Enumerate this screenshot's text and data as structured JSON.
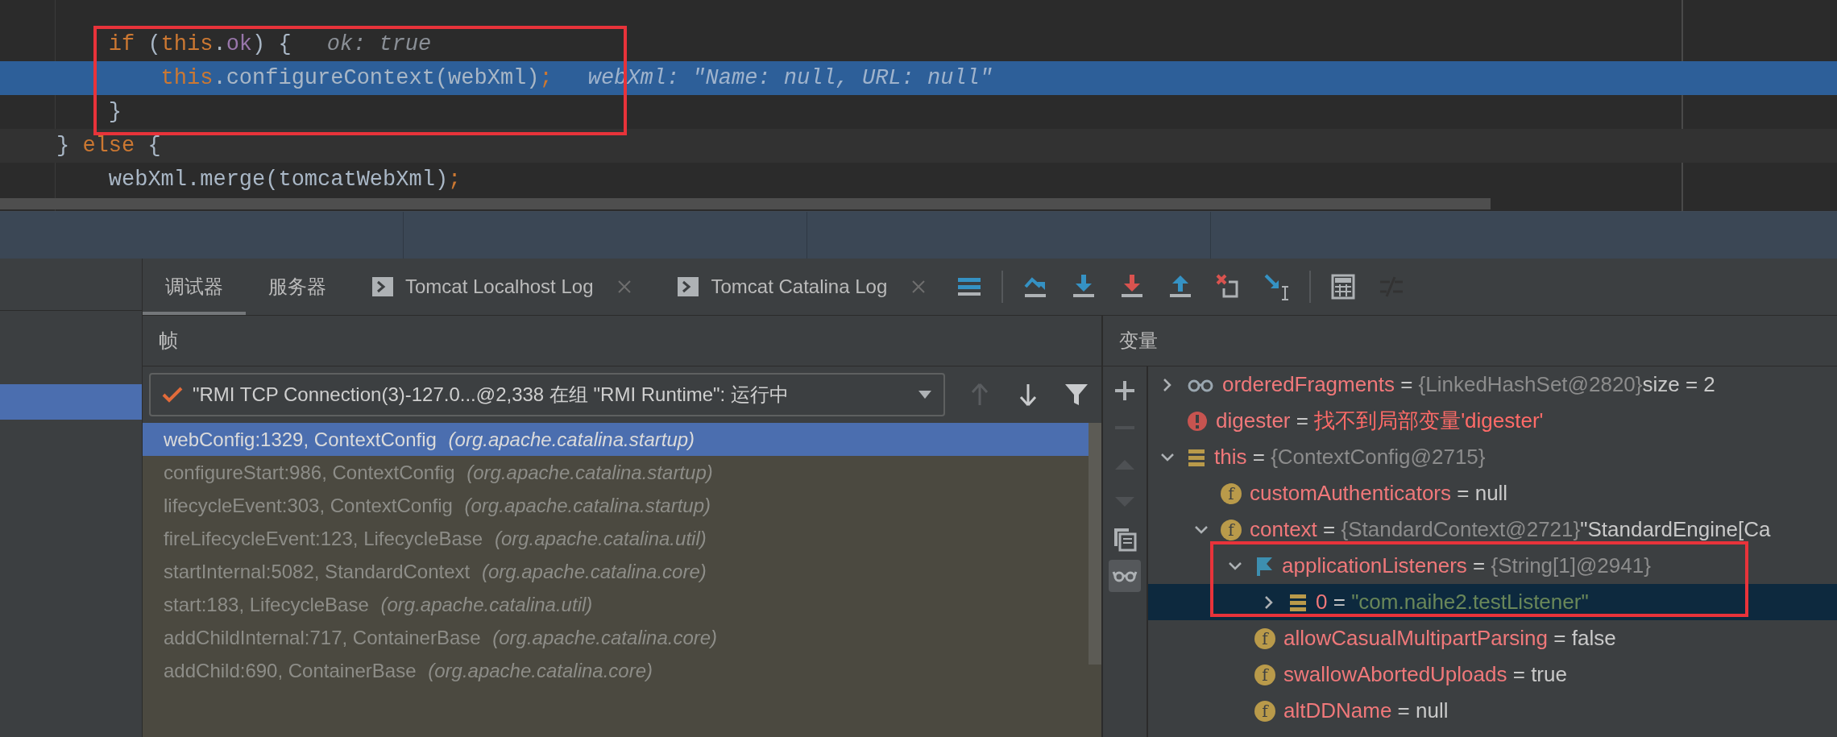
{
  "editor": {
    "lines": [
      {
        "kind": "plain",
        "tokens": [
          {
            "t": "    if",
            "kind": "keyword"
          },
          {
            "t": " (",
            "kind": "plain"
          },
          {
            "t": "this",
            "kind": "keyword"
          },
          {
            "t": ".",
            "kind": "plain"
          },
          {
            "t": "ok",
            "kind": "field"
          },
          {
            "t": ") {",
            "kind": "plain"
          }
        ],
        "hint": "ok: true"
      },
      {
        "kind": "execution",
        "tokens": [
          {
            "t": "        this",
            "kind": "keyword"
          },
          {
            "t": ".configureContext(webXml)",
            "kind": "plain"
          },
          {
            "t": ";",
            "kind": "keyword"
          }
        ],
        "hint": "webXml: \"Name: null, URL: null\""
      },
      {
        "kind": "plain",
        "tokens": [
          {
            "t": "    }",
            "kind": "plain"
          }
        ]
      },
      {
        "kind": "caret",
        "tokens": [
          {
            "t": "} ",
            "kind": "plain"
          },
          {
            "t": "else",
            "kind": "keyword"
          },
          {
            "t": " {",
            "kind": "plain"
          }
        ]
      },
      {
        "kind": "plain",
        "tokens": [
          {
            "t": "    webXml.merge(tomcatWebXml)",
            "kind": "plain"
          },
          {
            "t": ";",
            "kind": "keyword"
          }
        ]
      }
    ]
  },
  "tabs": [
    {
      "label": "调试器",
      "selected": true,
      "kind": "plain"
    },
    {
      "label": "服务器",
      "selected": false,
      "kind": "plain"
    },
    {
      "label": "Tomcat Localhost Log",
      "selected": false,
      "kind": "console"
    },
    {
      "label": "Tomcat Catalina Log",
      "selected": false,
      "kind": "console"
    }
  ],
  "toolbar": [
    {
      "kind": "lines",
      "disabled": false
    },
    {
      "kind": "over",
      "disabled": false
    },
    {
      "kind": "into",
      "disabled": false
    },
    {
      "kind": "force",
      "disabled": false
    },
    {
      "kind": "out",
      "disabled": false
    },
    {
      "kind": "drop",
      "disabled": false
    },
    {
      "kind": "cursor",
      "disabled": false
    },
    {
      "kind": "calc",
      "disabled": false
    },
    {
      "kind": "trace",
      "disabled": true
    }
  ],
  "frames": {
    "header": "帧",
    "thread": "\"RMI TCP Connection(3)-127.0...@2,338 在组 \"RMI Runtime\": 运行中",
    "tools": [
      {
        "kind": "up",
        "disabled": true
      },
      {
        "kind": "down",
        "disabled": false
      },
      {
        "kind": "filter",
        "disabled": false
      }
    ],
    "items": [
      {
        "location": "webConfig:1329, ContextConfig",
        "package": "(org.apache.catalina.startup)",
        "selected": true
      },
      {
        "location": "configureStart:986, ContextConfig",
        "package": "(org.apache.catalina.startup)",
        "selected": false
      },
      {
        "location": "lifecycleEvent:303, ContextConfig",
        "package": "(org.apache.catalina.startup)",
        "selected": false
      },
      {
        "location": "fireLifecycleEvent:123, LifecycleBase",
        "package": "(org.apache.catalina.util)",
        "selected": false
      },
      {
        "location": "startInternal:5082, StandardContext",
        "package": "(org.apache.catalina.core)",
        "selected": false
      },
      {
        "location": "start:183, LifecycleBase",
        "package": "(org.apache.catalina.util)",
        "selected": false
      },
      {
        "location": "addChildInternal:717, ContainerBase",
        "package": "(org.apache.catalina.core)",
        "selected": false
      },
      {
        "location": "addChild:690, ContainerBase",
        "package": "(org.apache.catalina.core)",
        "selected": false
      }
    ]
  },
  "variables": {
    "header": "变量",
    "tools": [
      {
        "kind": "plus",
        "disabled": false,
        "on": false
      },
      {
        "kind": "minus",
        "disabled": true,
        "on": false
      },
      {
        "kind": "up",
        "disabled": true,
        "on": false
      },
      {
        "kind": "down",
        "disabled": true,
        "on": false
      },
      {
        "kind": "copy",
        "disabled": false,
        "on": false
      },
      {
        "kind": "glasses",
        "disabled": false,
        "on": true
      }
    ],
    "nodes": [
      {
        "kind": "watch",
        "name": "orderedFragments",
        "op": "=",
        "value": {
          "text": "{LinkedHashSet@2820}",
          "kind": "ref"
        },
        "extra": "size = 2",
        "expanded": false,
        "selected": false
      },
      {
        "kind": "error",
        "name": "digester",
        "op": "=",
        "value": {
          "text": "找不到局部变量'digester'",
          "kind": "error"
        },
        "selected": false
      },
      {
        "kind": "list",
        "name": "this",
        "op": "=",
        "value": {
          "text": "{ContextConfig@2715}",
          "kind": "ref"
        },
        "expanded": true,
        "selected": false,
        "children": [
          {
            "kind": "field",
            "icon_text": "f",
            "name": "customAuthenticators",
            "op": "=",
            "value": {
              "text": "null",
              "kind": "literal"
            },
            "selected": false
          },
          {
            "kind": "field",
            "icon_text": "f",
            "name": "context",
            "op": "=",
            "value": {
              "text": "{StandardContext@2721}",
              "kind": "ref"
            },
            "extra": "\"StandardEngine[Ca",
            "expanded": true,
            "selected": false,
            "children": [
              {
                "kind": "flag",
                "name": "applicationListeners",
                "op": "=",
                "value": {
                  "text": "{String[1]@2941}",
                  "kind": "ref"
                },
                "expanded": true,
                "selected": false,
                "children": [
                  {
                    "kind": "list",
                    "name": "0",
                    "op": "=",
                    "value": {
                      "text": "\"com.naihe2.testListener\"",
                      "kind": "string"
                    },
                    "expanded": false,
                    "selected": true
                  }
                ]
              },
              {
                "kind": "field",
                "icon_text": "f",
                "name": "allowCasualMultipartParsing",
                "op": "=",
                "value": {
                  "text": "false",
                  "kind": "literal"
                },
                "selected": false
              },
              {
                "kind": "field",
                "icon_text": "f",
                "name": "swallowAbortedUploads",
                "op": "=",
                "value": {
                  "text": "true",
                  "kind": "literal"
                },
                "selected": false
              },
              {
                "kind": "field",
                "icon_text": "f",
                "name": "altDDName",
                "op": "=",
                "value": {
                  "text": "null",
                  "kind": "literal"
                },
                "selected": false
              }
            ]
          }
        ]
      }
    ]
  }
}
